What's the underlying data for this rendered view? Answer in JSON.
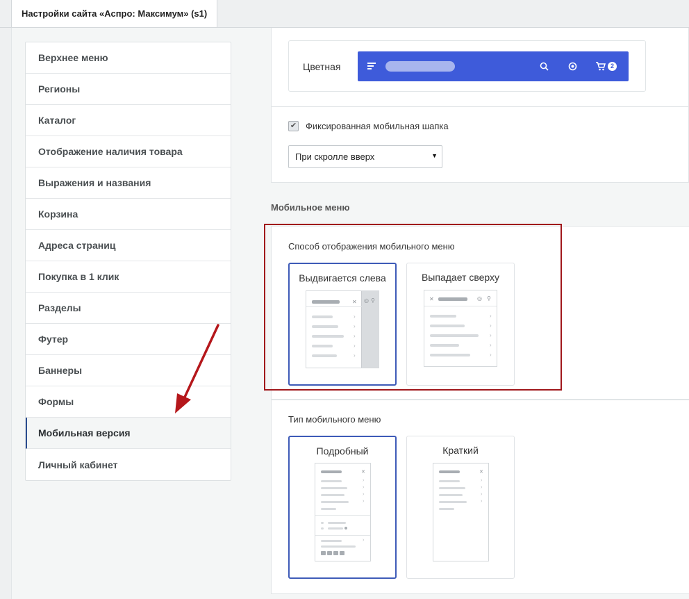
{
  "tab": {
    "title": "Настройки сайта «Аспро: Максимум» (s1)"
  },
  "sidebar": {
    "items": [
      {
        "label": "Верхнее меню"
      },
      {
        "label": "Регионы"
      },
      {
        "label": "Каталог"
      },
      {
        "label": "Отображение наличия товара"
      },
      {
        "label": "Выражения и названия"
      },
      {
        "label": "Корзина"
      },
      {
        "label": "Адреса страниц"
      },
      {
        "label": "Покупка в 1 клик"
      },
      {
        "label": "Разделы"
      },
      {
        "label": "Футер"
      },
      {
        "label": "Баннеры"
      },
      {
        "label": "Формы"
      },
      {
        "label": "Мобильная версия",
        "active": true
      },
      {
        "label": "Личный кабинет"
      }
    ]
  },
  "header_color": {
    "label": "Цветная",
    "accent": "#3e5bda",
    "cart_count": "2",
    "icons": [
      "menu-icon",
      "search-icon",
      "user-icon",
      "cart-icon"
    ]
  },
  "fixed_header": {
    "checkbox_label": "Фиксированная мобильная шапка",
    "checked": true,
    "select_value": "При скролле вверх"
  },
  "mobile_menu": {
    "section_title": "Мобильное меню",
    "display_mode": {
      "label": "Способ отображения мобильного меню",
      "options": [
        {
          "label": "Выдвигается слева",
          "selected": true
        },
        {
          "label": "Выпадает сверху",
          "selected": false
        }
      ]
    },
    "menu_type": {
      "label": "Тип мобильного меню",
      "options": [
        {
          "label": "Подробный",
          "selected": true
        },
        {
          "label": "Краткий",
          "selected": false
        }
      ]
    }
  },
  "colors": {
    "highlight_frame": "#a0171b",
    "arrow": "#b5171b",
    "selected_border": "#3e5bb8"
  }
}
